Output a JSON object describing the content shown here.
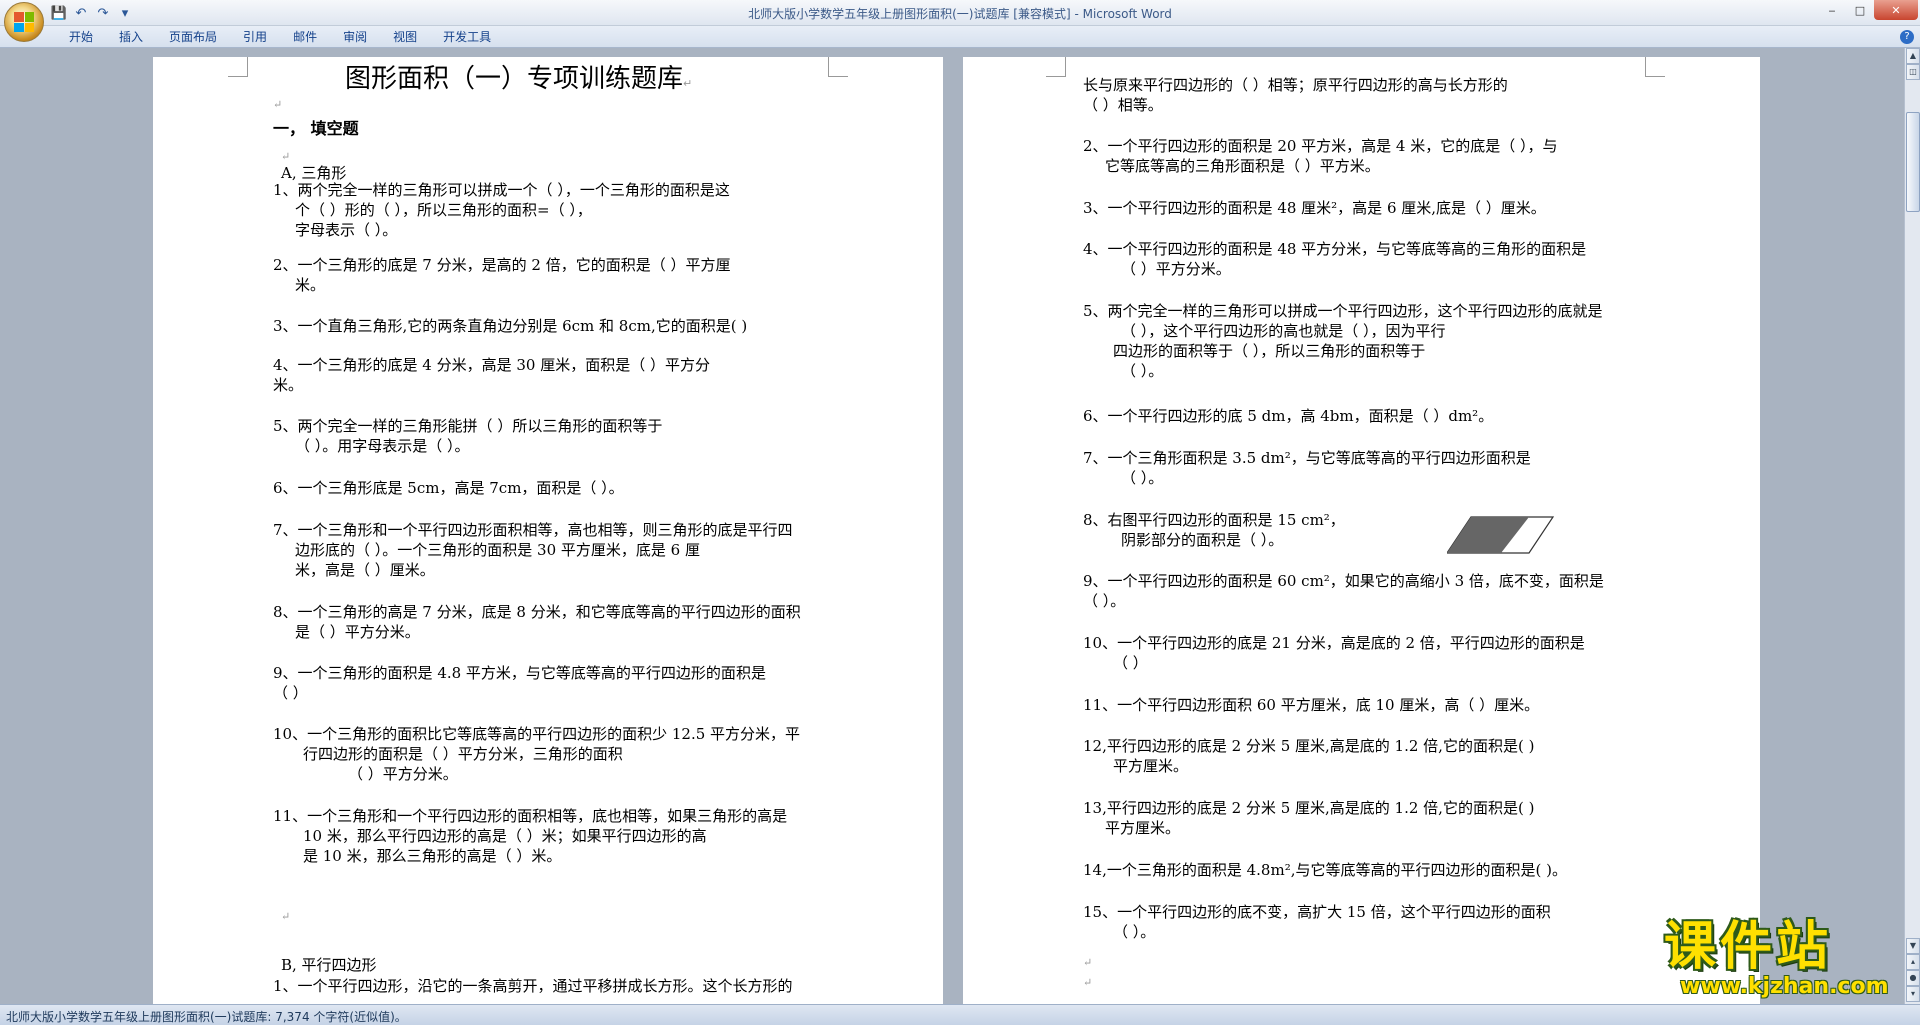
{
  "window": {
    "title": "北师大版小学数学五年级上册图形面积(一)试题库 [兼容模式] - Microsoft Word",
    "controls": [
      "minimize-icon",
      "maximize-icon",
      "close-icon"
    ]
  },
  "quick_access": [
    "save-icon",
    "undo-icon",
    "redo-icon",
    "customize-icon"
  ],
  "ribbon": {
    "tabs": [
      "开始",
      "插入",
      "页面布局",
      "引用",
      "邮件",
      "审阅",
      "视图",
      "开发工具"
    ]
  },
  "left_page": {
    "title": "图形面积（一）专项训练题库",
    "section_heading": "一，  填空题",
    "subsection_a": "A,     三角形",
    "q1": [
      "1、两个完全一样的三角形可以拼成一个（            ），一个三角形的面积是这",
      "个（            ）形的（          ），所以三角形的面积=（              ），",
      "字母表示（            ）。"
    ],
    "q2": [
      "2、一个三角形的底是 7 分米，是高的 2 倍，它的面积是（          ）平方厘",
      "米。"
    ],
    "q3": [
      "3、一个直角三角形,它的两条直角边分别是 6cm 和 8cm,它的面积是(            )"
    ],
    "q4": [
      "4、一个三角形的底是 4 分米，高是 30 厘米，面积是（              ）平方分",
      "米。"
    ],
    "q5": [
      "5、两个完全一样的三角形能拼（              ）所以三角形的面积等于",
      "（          ）。用字母表示是（            ）。"
    ],
    "q6": [
      "6、一个三角形底是 5cm，高是 7cm，面积是（            ）。"
    ],
    "q7": [
      "7、一个三角形和一个平行四边形面积相等，高也相等，则三角形的底是平行四",
      "边形底的（              ）。一个三角形的面积是 30 平方厘米，底是 6 厘",
      "米，高是（            ）厘米。"
    ],
    "q8": [
      "8、一个三角形的高是 7 分米，底是 8 分米，和它等底等高的平行四边形的面积",
      "是（            ）平方分米。"
    ],
    "q9": [
      "9、一个三角形的面积是 4.8 平方米，与它等底等高的平行四边形的面积是",
      "（          ）"
    ],
    "q10": [
      "10、一个三角形的面积比它等底等高的平行四边形的面积少 12.5 平方分米，平",
      "行四边形的面积是（              ）平方分米，三角形的面积",
      "（            ）平方分米。"
    ],
    "q11": [
      "11、一个三角形和一个平行四边形的面积相等，底也相等，如果三角形的高是",
      "10 米，那么平行四边形的高是（              ）米；如果平行四边形的高",
      "是 10 米，那么三角形的高是（              ）米。"
    ],
    "subsection_b": "B,     平行四边形",
    "qb1": [
      "1、一个平行四边形，沿它的一条高剪开，通过平移拼成长方形。这个长方形的"
    ]
  },
  "right_page": {
    "qb1_cont": [
      "长与原来平行四边形的（              ）相等；原平行四边形的高与长方形的",
      "（            ）相等。"
    ],
    "qb2": [
      "2、一个平行四边形的面积是 20 平方米，高是 4 米，它的底是（            ），与",
      "它等底等高的三角形面积是（              ）平方米。"
    ],
    "qb3": [
      "3、一个平行四边形的面积是 48 厘米²，高是 6 厘米,底是（            ）厘米。"
    ],
    "qb4": [
      "4、一个平行四边形的面积是  48  平方分米，与它等底等高的三角形的面积是",
      "（            ）平方分米。"
    ],
    "qb5": [
      "5、两个完全一样的三角形可以拼成一个平行四边形，这个平行四边形的底就是",
      "（          ），这个平行四边形的高也就是（                  ），因为平行",
      "四边形的面积等于（                  ），所以三角形的面积等于",
      "（            ）。"
    ],
    "qb6": [
      "6、一个平行四边形的底 5 dm，高 4bm，面积是（            ）dm²。"
    ],
    "qb7": [
      "7、一个三角形面积是  3.5  dm²，与它等底等高的平行四边形面积是",
      "（            ）。"
    ],
    "qb8": [
      "8、右图平行四边形的面积是 15 cm²，",
      "阴影部分的面积是（              ）。"
    ],
    "qb9": [
      "9、一个平行四边形的面积是  60  cm²，如果它的高缩小  3  倍，底不变，面积是",
      "（          ）。"
    ],
    "qb10": [
      "10、一个平行四边形的底是  21  分米，高是底的  2  倍，平行四边形的面积是",
      "（            ）"
    ],
    "qb11": [
      "11、一个平行四边形面积 60 平方厘米，底 10 厘米，高（            ）厘米。"
    ],
    "qb12": [
      "12,平行四边形的底是 2 分米 5 厘米,高是底的 1.2 倍,它的面积是(              )",
      "平方厘米。"
    ],
    "qb13": [
      "13,平行四边形的底是 2 分米 5 厘米,高是底的 1.2 倍,它的面积是(              )",
      "平方厘米。"
    ],
    "qb14": [
      "14,一个三角形的面积是 4.8m²,与它等底等高的平行四边形的面积是(            )。"
    ],
    "qb15": [
      "15、一个平行四边形的底不变，高扩大  15  倍，这个平行四边形的面积",
      "（            ）。"
    ]
  },
  "status": {
    "text": "北师大版小学数学五年级上册图形面积(一)试题库: 7,374 个字符(近似值)。"
  },
  "watermark": {
    "main": "课件站",
    "url": "www.kjzhan.com"
  }
}
